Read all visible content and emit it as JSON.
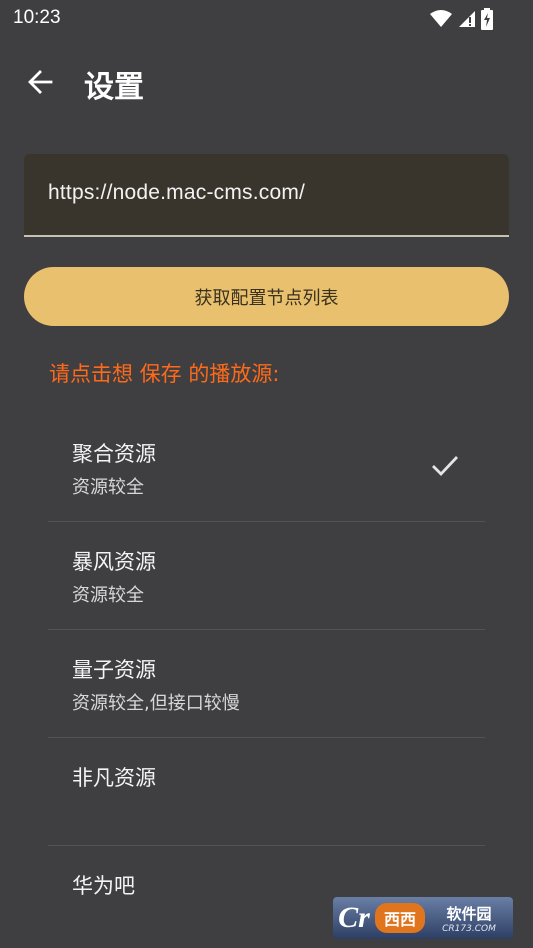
{
  "status_bar": {
    "time": "10:23"
  },
  "header": {
    "title": "设置"
  },
  "url_field": {
    "value": "https://node.mac-cms.com/"
  },
  "fetch_button": {
    "label": "获取配置节点列表"
  },
  "prompt": {
    "text": "请点击想 保存 的播放源:"
  },
  "sources": [
    {
      "name": "聚合资源",
      "desc": "资源较全",
      "selected": true
    },
    {
      "name": "暴风资源",
      "desc": "资源较全",
      "selected": false
    },
    {
      "name": "量子资源",
      "desc": "资源较全,但接口较慢",
      "selected": false
    },
    {
      "name": "非凡资源",
      "desc": "",
      "selected": false
    },
    {
      "name": "华为吧",
      "desc": "",
      "selected": false
    }
  ],
  "watermark": {
    "mark": "Cr",
    "site": "西西",
    "name": "软件园",
    "url": "CR173.COM"
  },
  "colors": {
    "background": "#3f3f41",
    "accent": "#e9c06d",
    "prompt": "#ff6a1a"
  },
  "icons": {
    "back": "arrow-left-icon",
    "check": "check-icon",
    "wifi": "wifi-icon",
    "signal": "signal-icon",
    "battery": "battery-icon"
  }
}
